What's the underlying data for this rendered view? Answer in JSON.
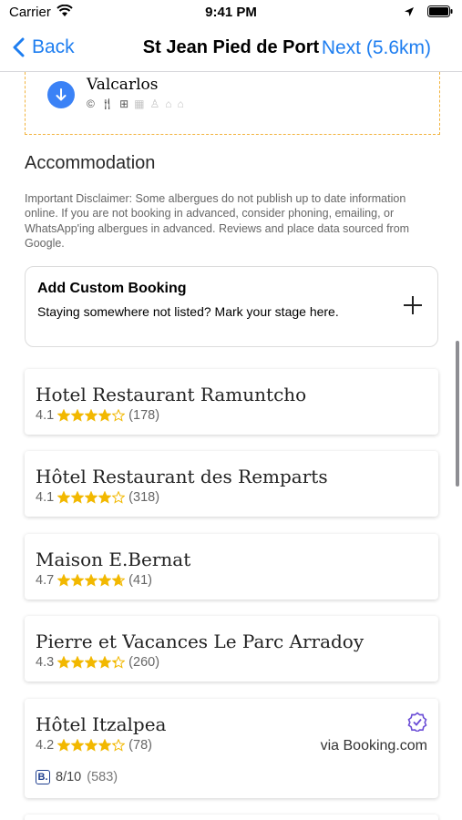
{
  "status_bar": {
    "carrier": "Carrier",
    "time": "9:41 PM"
  },
  "nav": {
    "back_label": "Back",
    "title": "St Jean Pied de Port",
    "next_label": "Next (5.6km)"
  },
  "stage": {
    "name": "Valcarlos",
    "icons": [
      "euro-icon",
      "fork-knife-icon",
      "cart-icon",
      "building-icon",
      "bottle-icon",
      "church-icon",
      "house-icon"
    ]
  },
  "accommodation": {
    "title": "Accommodation",
    "disclaimer": "Important Disclaimer: Some albergues do not publish up to date information online. If you are not booking in advanced, consider phoning, emailing, or WhatsApp'ing albergues in advanced. Reviews and place data sourced from Google.",
    "custom_booking": {
      "title": "Add Custom Booking",
      "subtitle": "Staying somewhere not listed? Mark your stage here."
    },
    "hotels": [
      {
        "name": "Hotel Restaurant Ramuntcho",
        "rating": "4.1",
        "stars": 4.1,
        "reviews": "(178)"
      },
      {
        "name": "Hôtel Restaurant des Remparts",
        "rating": "4.1",
        "stars": 4.1,
        "reviews": "(318)"
      },
      {
        "name": "Maison E.Bernat",
        "rating": "4.7",
        "stars": 4.7,
        "reviews": "(41)"
      },
      {
        "name": "Pierre et Vacances Le Parc Arradoy",
        "rating": "4.3",
        "stars": 4.3,
        "reviews": "(260)"
      },
      {
        "name": "Hôtel Itzalpea",
        "rating": "4.2",
        "stars": 4.2,
        "reviews": "(78)",
        "via": "via Booking.com",
        "booking_score": "8/10",
        "booking_reviews": "(583)"
      }
    ]
  },
  "colors": {
    "accent": "#1e7ef0",
    "star": "#f2b800",
    "dashed_border": "#f2b33d",
    "verified": "#6a4cd6"
  }
}
